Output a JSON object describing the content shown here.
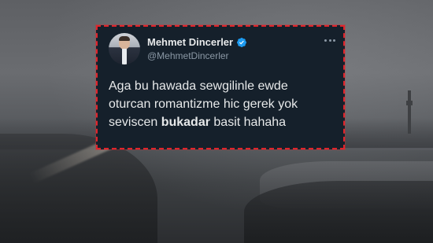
{
  "tweet": {
    "name": "Mehmet Dincerler",
    "handle": "@MehmetDincerler",
    "line1": "Aga bu hawada sewgilinle ewde",
    "line2": "oturcan romantizme hic gerek yok",
    "line3_pre": "seviscen ",
    "line3_bold": "bukadar",
    "line3_post": " basit hahaha"
  },
  "colors": {
    "card_bg": "#15202b",
    "border": "#e0242b",
    "verified": "#1d9bf0",
    "text": "#e7e9ea",
    "muted": "#8b98a5"
  },
  "icons": {
    "verified": "verified-badge-icon",
    "more": "more-options-icon"
  }
}
